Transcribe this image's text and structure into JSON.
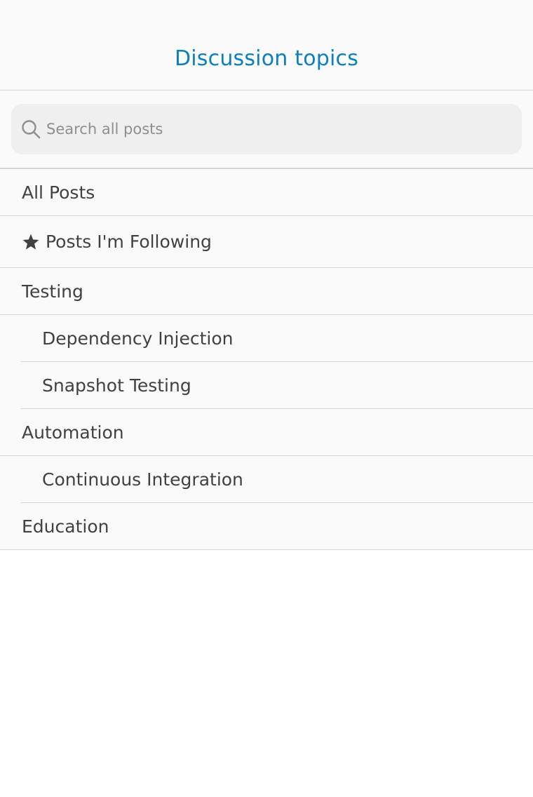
{
  "header": {
    "title": "Discussion topics"
  },
  "search": {
    "placeholder": "Search all posts",
    "value": ""
  },
  "topics": [
    {
      "label": "All Posts"
    },
    {
      "label": "Posts I'm Following",
      "icon": "star-icon"
    },
    {
      "label": "Testing"
    },
    {
      "label": "Dependency Injection"
    },
    {
      "label": "Snapshot Testing"
    },
    {
      "label": "Automation"
    },
    {
      "label": "Continuous Integration"
    },
    {
      "label": "Education"
    }
  ],
  "colors": {
    "accent": "#0b7fbf",
    "text": "#414141",
    "separator": "#d4d4d4",
    "search_background": "#efefef"
  }
}
